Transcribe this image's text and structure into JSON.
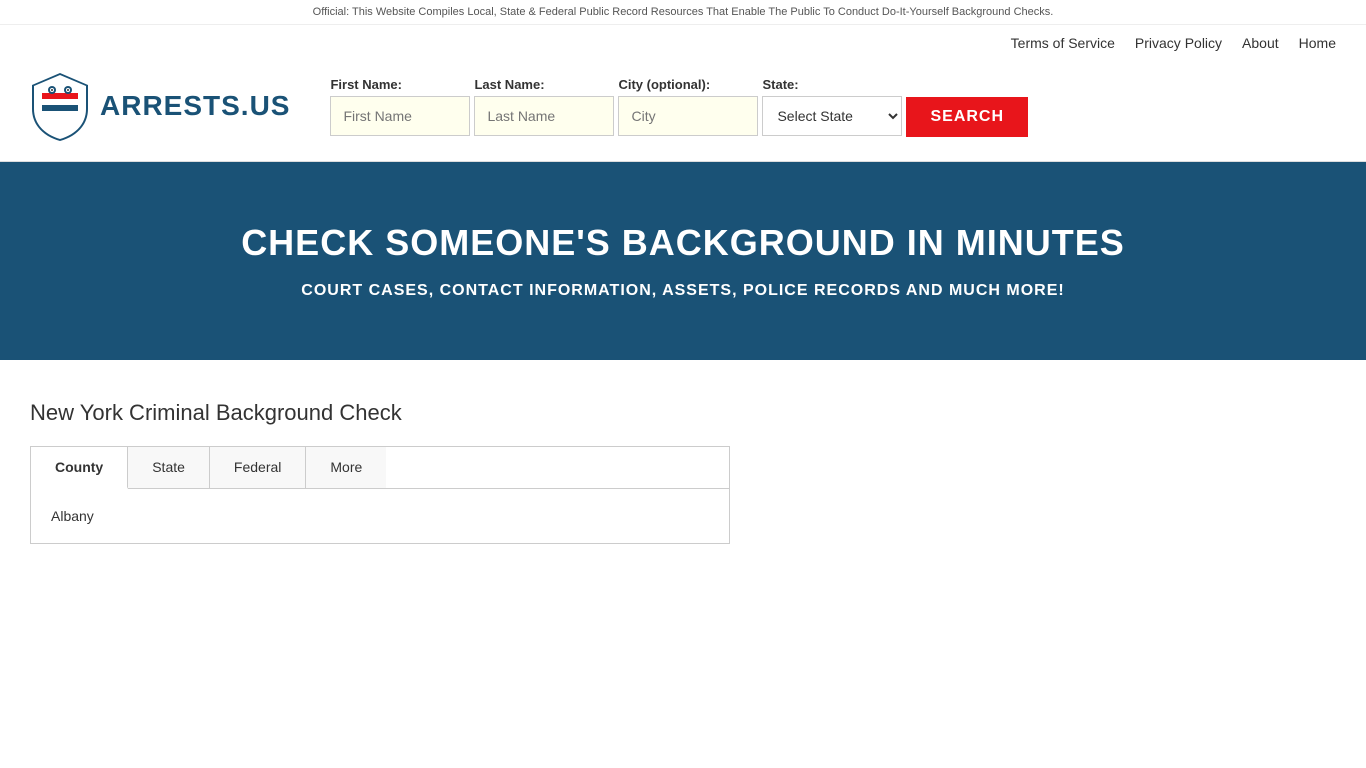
{
  "announcement": {
    "text": "Official: This Website Compiles Local, State & Federal Public Record Resources That Enable The Public To Conduct Do-It-Yourself Background Checks."
  },
  "nav": {
    "links": [
      {
        "label": "Terms of Service",
        "href": "#"
      },
      {
        "label": "Privacy Policy",
        "href": "#"
      },
      {
        "label": "About",
        "href": "#"
      },
      {
        "label": "Home",
        "href": "#"
      }
    ]
  },
  "logo": {
    "text": "ARRESTS.US"
  },
  "search": {
    "first_name_label": "First Name:",
    "last_name_label": "Last Name:",
    "city_label": "City (optional):",
    "state_label": "State:",
    "first_name_placeholder": "First Name",
    "last_name_placeholder": "Last Name",
    "city_placeholder": "City",
    "state_placeholder": "Select State",
    "button_label": "SEARCH"
  },
  "hero": {
    "title": "CHECK SOMEONE'S BACKGROUND IN MINUTES",
    "subtitle": "COURT CASES, CONTACT INFORMATION, ASSETS, POLICE RECORDS AND MUCH MORE!"
  },
  "main": {
    "section_title": "New York Criminal Background Check",
    "tabs": [
      {
        "label": "County",
        "active": true
      },
      {
        "label": "State",
        "active": false
      },
      {
        "label": "Federal",
        "active": false
      },
      {
        "label": "More",
        "active": false
      }
    ],
    "county_items": [
      "Albany"
    ]
  }
}
